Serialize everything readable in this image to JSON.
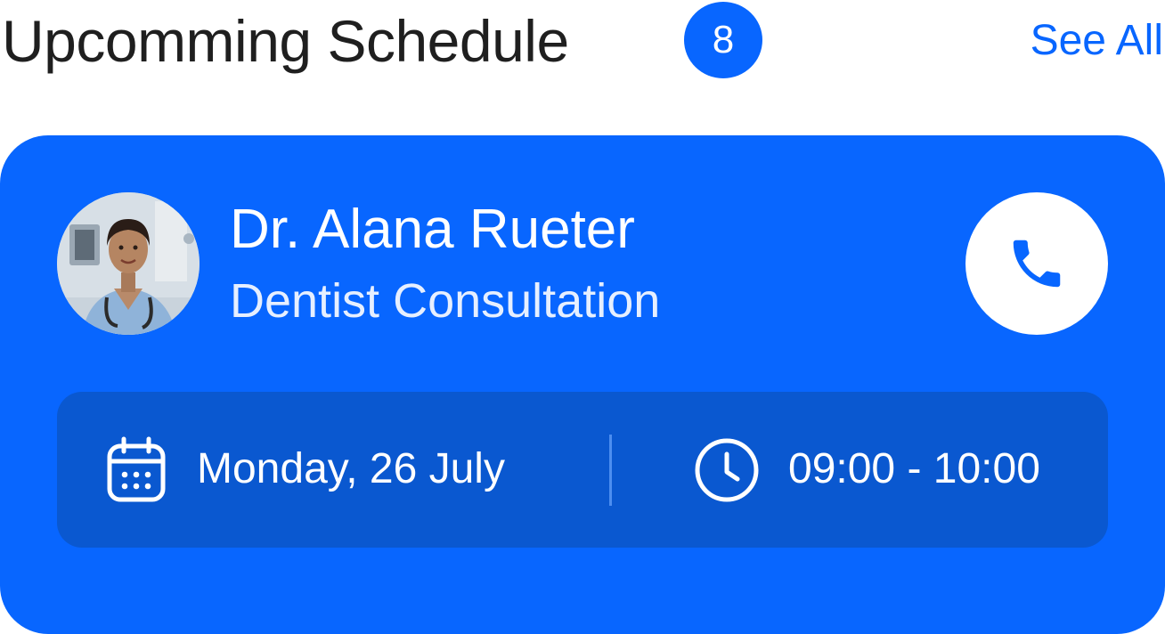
{
  "header": {
    "title": "Upcomming Schedule",
    "count": "8",
    "see_all_label": "See All"
  },
  "appointment": {
    "doctor_name": "Dr. Alana Rueter",
    "consultation_type": "Dentist Consultation",
    "date": "Monday, 26 July",
    "time": "09:00 - 10:00"
  },
  "icons": {
    "call": "phone-icon",
    "date": "calendar-icon",
    "time": "clock-icon"
  },
  "colors": {
    "accent": "#0866ff",
    "panel": "#0a58d0",
    "title_text": "#1f1f1f"
  }
}
